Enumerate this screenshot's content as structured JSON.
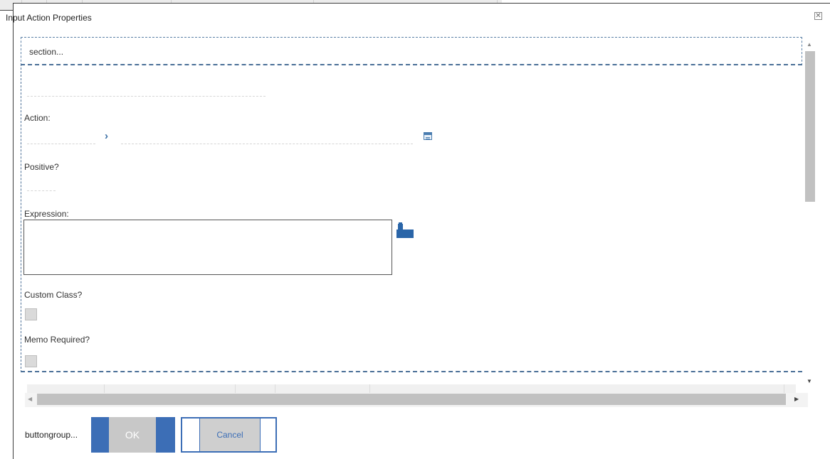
{
  "dialog": {
    "title": "Input Action Properties",
    "close_glyph": "✕"
  },
  "section": {
    "label": "section..."
  },
  "form": {
    "action_label": "Action:",
    "positive_label": "Positive?",
    "expression_label": "Expression:",
    "expression_value": "",
    "custom_class_label": "Custom Class?",
    "memo_required_label": "Memo Required?"
  },
  "icons": {
    "chevron": "chevron-right-icon",
    "calendar": "form-lookup-icon",
    "expression_builder": "expression-builder-icon"
  },
  "buttons": {
    "group_label": "buttongroup...",
    "ok_label": "OK",
    "cancel_label": "Cancel"
  },
  "colors": {
    "accent": "#3c6eb6",
    "button_fill": "#c8c8c8"
  }
}
